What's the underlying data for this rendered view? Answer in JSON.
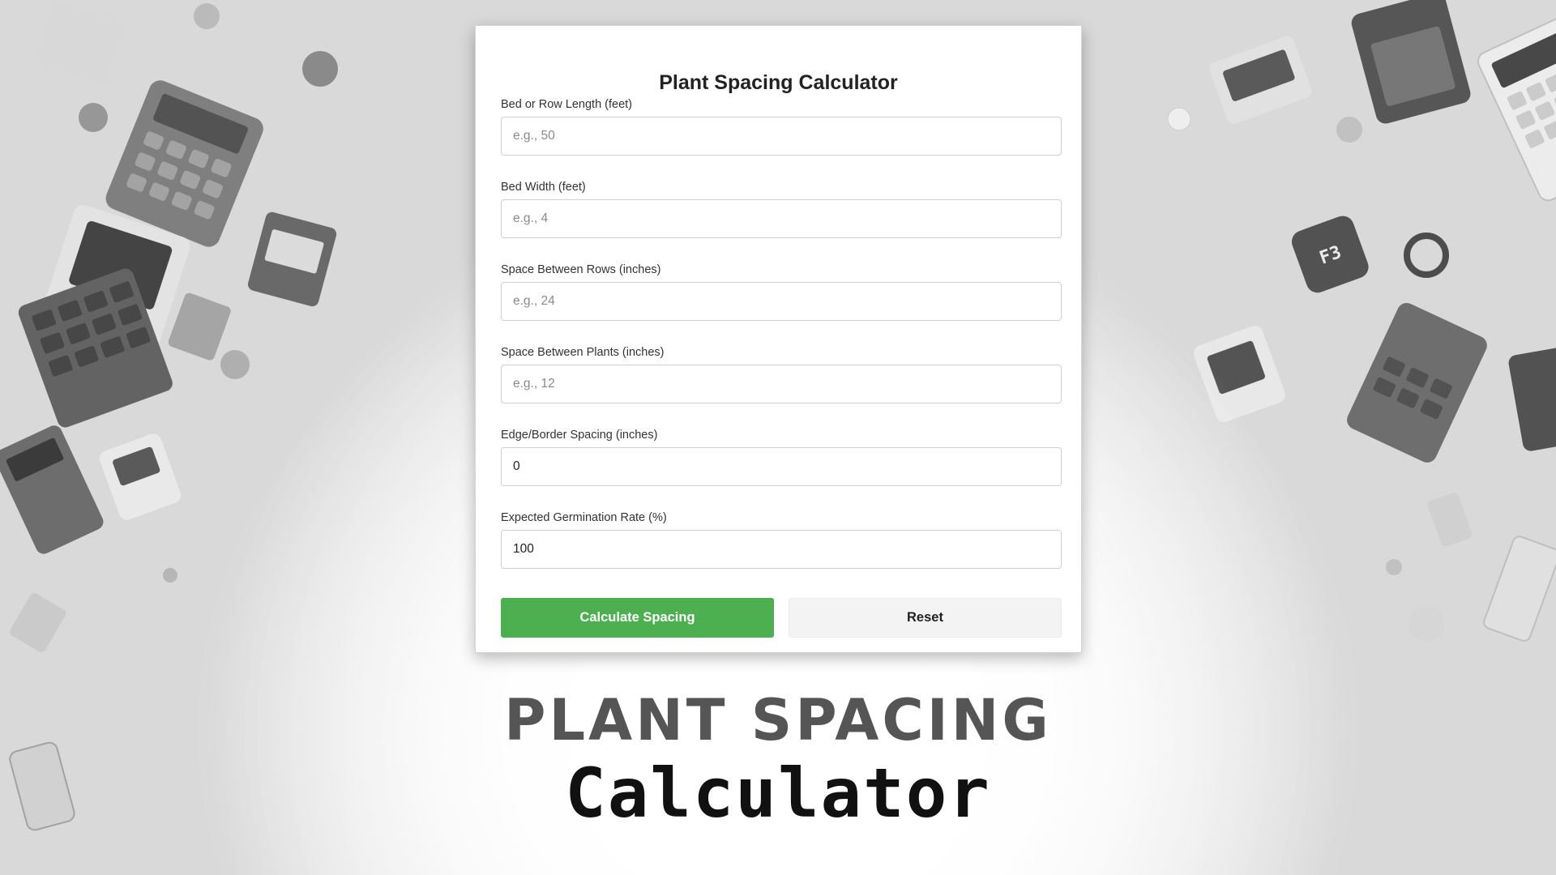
{
  "form": {
    "title": "Plant Spacing Calculator",
    "fields": [
      {
        "label": "Bed or Row Length (feet)",
        "value": "",
        "placeholder": "e.g., 50"
      },
      {
        "label": "Bed Width (feet)",
        "value": "",
        "placeholder": "e.g., 4"
      },
      {
        "label": "Space Between Rows (inches)",
        "value": "",
        "placeholder": "e.g., 24"
      },
      {
        "label": "Space Between Plants (inches)",
        "value": "",
        "placeholder": "e.g., 12"
      },
      {
        "label": "Edge/Border Spacing (inches)",
        "value": "0",
        "placeholder": ""
      },
      {
        "label": "Expected Germination Rate (%)",
        "value": "100",
        "placeholder": ""
      }
    ],
    "buttons": {
      "calculate_label": "Calculate Spacing",
      "reset_label": "Reset"
    }
  },
  "hero": {
    "line1": "PLANT SPACING",
    "line2": "Calculator"
  },
  "colors": {
    "accent": "#4caf50",
    "reset_bg": "#f3f3f3",
    "heading": "#555555"
  },
  "icons": {
    "background": "calculator-collage-image"
  }
}
